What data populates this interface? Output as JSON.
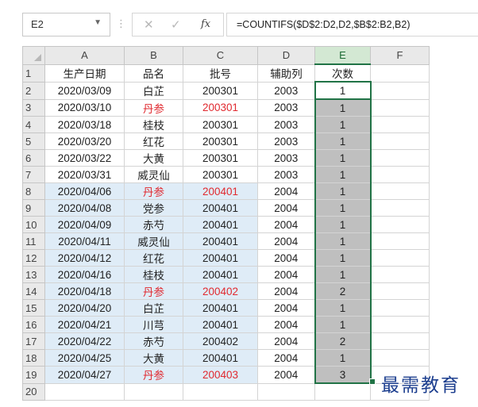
{
  "name_box": "E2",
  "formula_bar": {
    "cancel_symbol": "✕",
    "enter_symbol": "✓",
    "fx_symbol": "fx",
    "formula": "=COUNTIFS($D$2:D2,D2,$B$2:B2,B2)"
  },
  "columns": [
    "A",
    "B",
    "C",
    "D",
    "E",
    "F"
  ],
  "selected_column": "E",
  "headers": [
    "生产日期",
    "品名",
    "批号",
    "辅助列",
    "次数"
  ],
  "rows": [
    {
      "date": "2020/03/09",
      "name": "白芷",
      "batch": "200301",
      "aux": "2003",
      "count": "1",
      "red": false
    },
    {
      "date": "2020/03/10",
      "name": "丹参",
      "batch": "200301",
      "aux": "2003",
      "count": "1",
      "red": true
    },
    {
      "date": "2020/03/18",
      "name": "桂枝",
      "batch": "200301",
      "aux": "2003",
      "count": "1",
      "red": false
    },
    {
      "date": "2020/03/20",
      "name": "红花",
      "batch": "200301",
      "aux": "2003",
      "count": "1",
      "red": false
    },
    {
      "date": "2020/03/22",
      "name": "大黄",
      "batch": "200301",
      "aux": "2003",
      "count": "1",
      "red": false
    },
    {
      "date": "2020/03/31",
      "name": "威灵仙",
      "batch": "200301",
      "aux": "2003",
      "count": "1",
      "red": false
    },
    {
      "date": "2020/04/06",
      "name": "丹参",
      "batch": "200401",
      "aux": "2004",
      "count": "1",
      "red": true
    },
    {
      "date": "2020/04/08",
      "name": "党参",
      "batch": "200401",
      "aux": "2004",
      "count": "1",
      "red": false
    },
    {
      "date": "2020/04/09",
      "name": "赤芍",
      "batch": "200401",
      "aux": "2004",
      "count": "1",
      "red": false
    },
    {
      "date": "2020/04/11",
      "name": "威灵仙",
      "batch": "200401",
      "aux": "2004",
      "count": "1",
      "red": false
    },
    {
      "date": "2020/04/12",
      "name": "红花",
      "batch": "200401",
      "aux": "2004",
      "count": "1",
      "red": false
    },
    {
      "date": "2020/04/16",
      "name": "桂枝",
      "batch": "200401",
      "aux": "2004",
      "count": "1",
      "red": false
    },
    {
      "date": "2020/04/18",
      "name": "丹参",
      "batch": "200402",
      "aux": "2004",
      "count": "2",
      "red": true
    },
    {
      "date": "2020/04/20",
      "name": "白芷",
      "batch": "200401",
      "aux": "2004",
      "count": "1",
      "red": false
    },
    {
      "date": "2020/04/21",
      "name": "川芎",
      "batch": "200401",
      "aux": "2004",
      "count": "1",
      "red": false
    },
    {
      "date": "2020/04/22",
      "name": "赤芍",
      "batch": "200402",
      "aux": "2004",
      "count": "2",
      "red": false
    },
    {
      "date": "2020/04/25",
      "name": "大黄",
      "batch": "200401",
      "aux": "2004",
      "count": "1",
      "red": false
    },
    {
      "date": "2020/04/27",
      "name": "丹参",
      "batch": "200403",
      "aux": "2004",
      "count": "3",
      "red": true
    }
  ],
  "last_row_number": "20",
  "watermark": "最需教育",
  "colors": {
    "selection": "#217346",
    "red_text": "#e0292f",
    "row_shade": "#dfecf7",
    "selected_fill": "#bfbfbf"
  }
}
